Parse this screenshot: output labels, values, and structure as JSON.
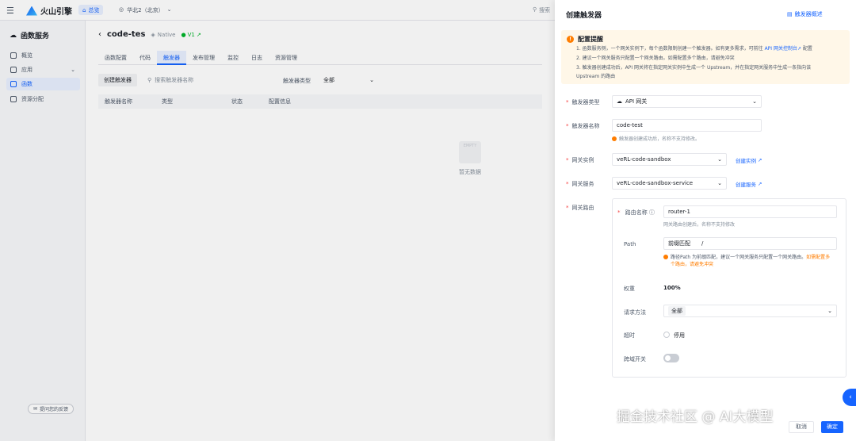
{
  "topbar": {
    "menu_icon": "menu-icon",
    "brand": "火山引擎",
    "home_label": "总览",
    "region": "华北2（北京）",
    "search_placeholder": "搜索"
  },
  "sidebar": {
    "title": "函数服务",
    "items": [
      {
        "label": "概览",
        "icon": "overview-icon"
      },
      {
        "label": "应用",
        "icon": "app-icon"
      },
      {
        "label": "函数",
        "icon": "function-icon"
      },
      {
        "label": "资源分配",
        "icon": "resource-icon"
      }
    ],
    "feedback": "提问您的反馈"
  },
  "main": {
    "function_name": "code-tes",
    "runtime": "Native",
    "version": "V1",
    "tabs": [
      "函数配置",
      "代码",
      "触发器",
      "发布管理",
      "监控",
      "日志",
      "资源管理"
    ],
    "active_tab": "触发器",
    "create_button": "创建触发器",
    "search_placeholder": "搜索触发器名称",
    "type_filter_label": "触发器类型",
    "type_filter_value": "全部",
    "columns": [
      "触发器名称",
      "类型",
      "状态",
      "配置信息"
    ],
    "empty_box_text": "EMPTY",
    "empty_text": "暂无数据"
  },
  "drawer": {
    "title": "创建触发器",
    "overview_link": "触发器概述",
    "notice": {
      "title": "配置提醒",
      "line1_prefix": "1. 函数服务侧，一个网关实例下，每个函数限制创建一个触发器。如有更多需求，可前往",
      "line1_link": "API 网关控制台",
      "line1_suffix": "配置",
      "line2": "2. 建议一个网关服务只配置一个网关路由。如需配置多个路由，请避免冲突",
      "line3": "3. 触发器创建成功后，API 网关将在指定网关实例中生成一个 Upstream，并在指定网关服务中生成一条指向该",
      "line4": "Upstream 的路由"
    },
    "trigger_type_label": "触发器类型",
    "trigger_type_value": "API 网关",
    "trigger_name_label": "触发器名称",
    "trigger_name_value": "code-test",
    "trigger_name_hint": "触发器创建成功后，名称不支持修改。",
    "gateway_instance_label": "网关实例",
    "gateway_instance_value": "veRL-code-sandbox",
    "create_instance_link": "创建实例",
    "gateway_service_label": "网关服务",
    "gateway_service_value": "veRL-code-sandbox-service",
    "create_service_link": "创建服务",
    "gateway_route_label": "网关路由",
    "route": {
      "name_label": "路由名称",
      "name_value": "router-1",
      "name_hint": "网关路由创建后，名称不支持修改",
      "path_label": "Path",
      "path_match": "前缀匹配",
      "path_value": "/",
      "path_hint_a": "路径Path 为前缀匹配，建议一个网关服务只配置一个网关路由。",
      "path_hint_b": "如需配置多",
      "path_hint_c": "个路由，请避免冲突",
      "weight_label": "权重",
      "weight_value": "100%",
      "method_label": "请求方法",
      "method_value": "全部",
      "timeout_label": "超时",
      "timeout_value": "停用",
      "cors_label": "跨域开关"
    },
    "cancel_button": "取消",
    "ok_button": "确定"
  },
  "watermark": "掘金技术社区 @ AI大模型",
  "colors": {
    "accent": "#1664ff",
    "warning": "#ff7d00",
    "notice_bg": "#fff7e8",
    "required": "#f53f3f"
  }
}
